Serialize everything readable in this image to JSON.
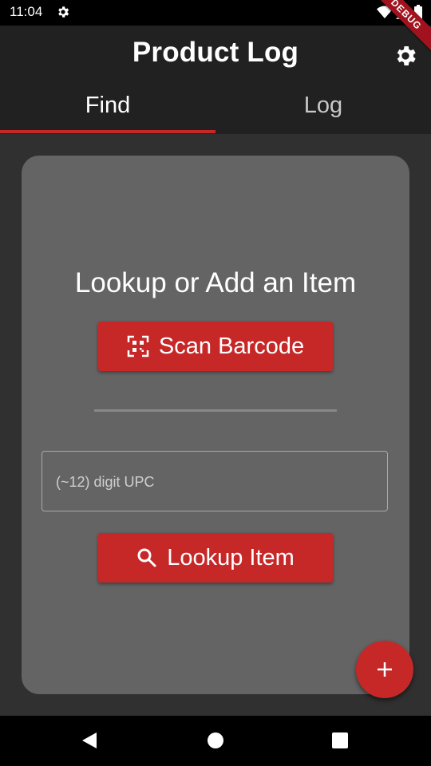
{
  "status_bar": {
    "time": "11:04"
  },
  "debug_banner": "DEBUG",
  "app_bar": {
    "title": "Product Log"
  },
  "tabs": [
    {
      "label": "Find",
      "selected": true
    },
    {
      "label": "Log",
      "selected": false
    }
  ],
  "find_card": {
    "heading": "Lookup or Add an Item",
    "scan_button_label": "Scan Barcode",
    "upc_input": {
      "placeholder": "(~12) digit UPC",
      "value": ""
    },
    "lookup_button_label": "Lookup Item"
  },
  "colors": {
    "accent": "#c62828",
    "app_bar": "#212121",
    "background": "#303030",
    "card": "#646464"
  },
  "icons": {
    "status_settings": "gear-icon",
    "app_settings": "gear-icon",
    "scan": "qr-code-scanner-icon",
    "lookup": "search-icon",
    "fab": "plus-icon",
    "nav_back": "back-triangle-icon",
    "nav_home": "home-circle-icon",
    "nav_recents": "recents-square-icon"
  }
}
